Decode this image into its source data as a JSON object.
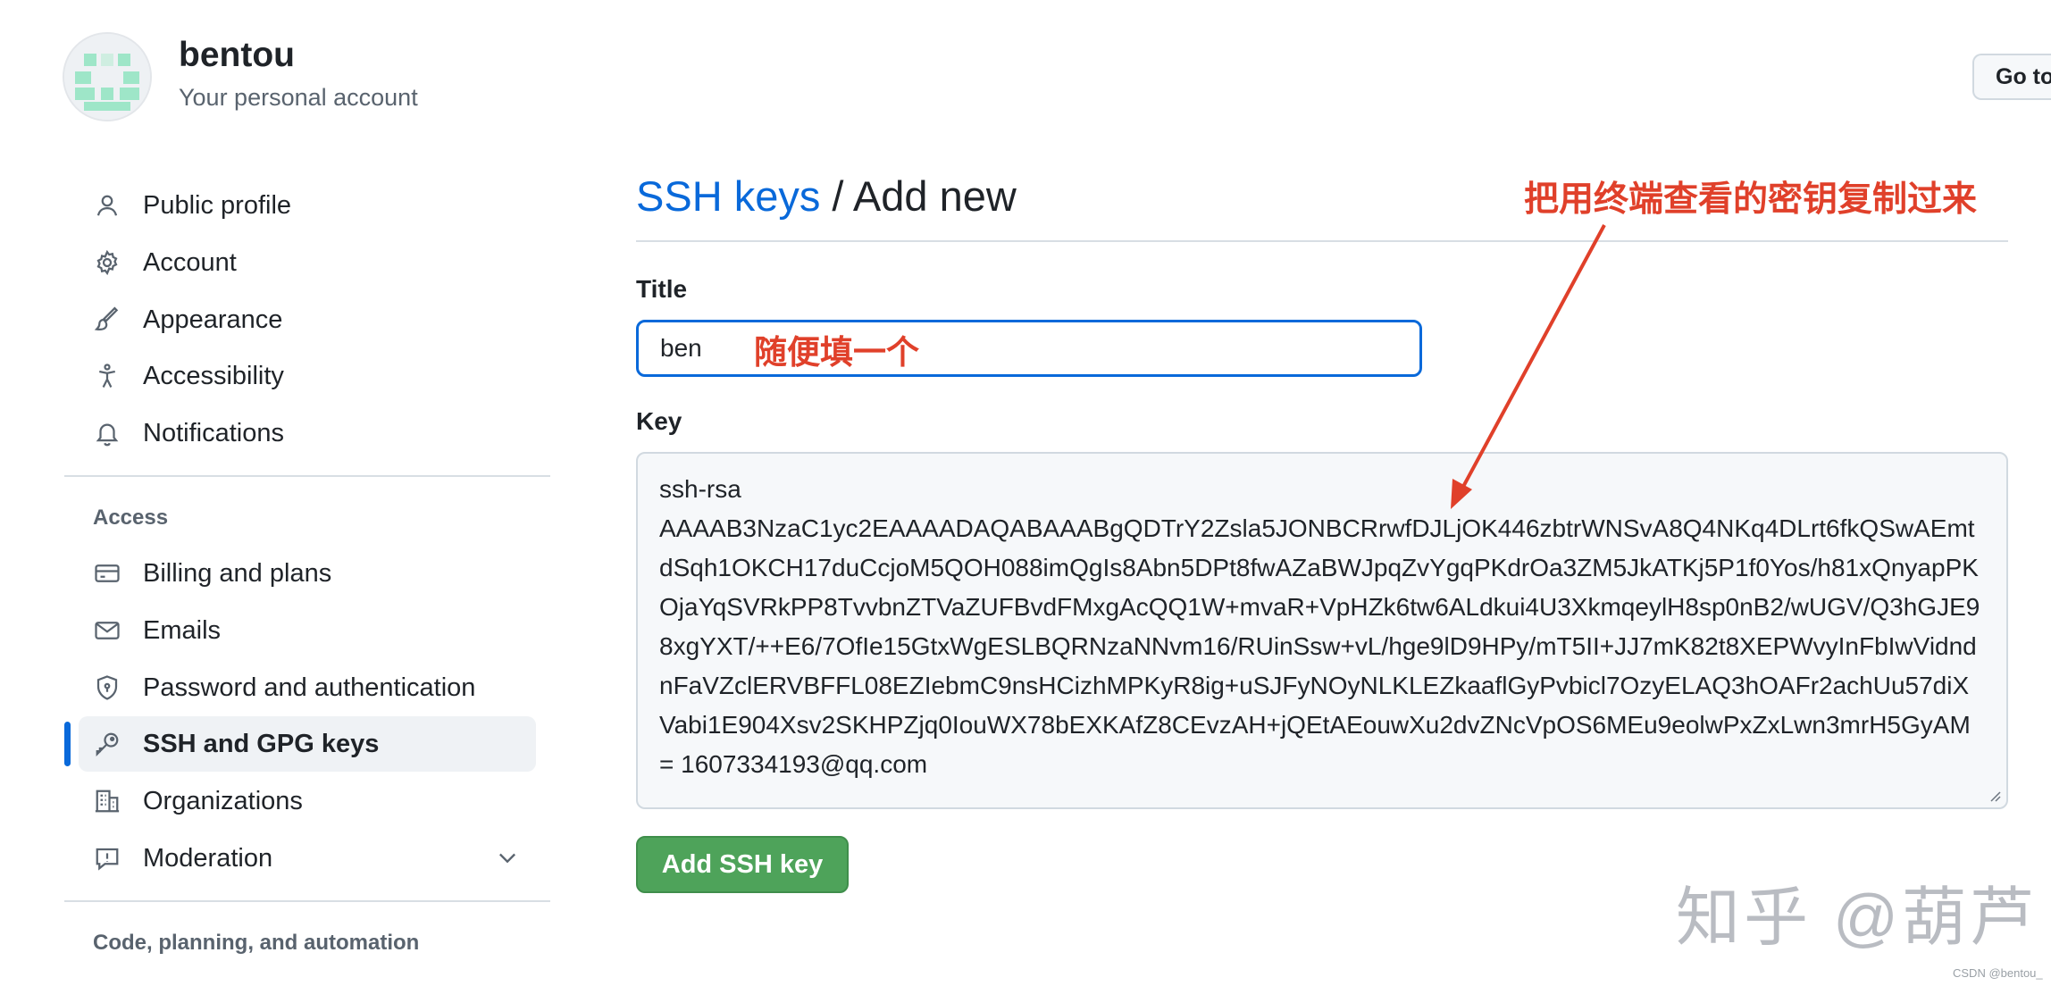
{
  "header": {
    "username": "bentou",
    "subtitle": "Your personal account",
    "goto_label": "Go to"
  },
  "sidebar": {
    "items": [
      {
        "label": "Public profile",
        "icon": "person-icon"
      },
      {
        "label": "Account",
        "icon": "gear-icon"
      },
      {
        "label": "Appearance",
        "icon": "paintbrush-icon"
      },
      {
        "label": "Accessibility",
        "icon": "accessibility-icon"
      },
      {
        "label": "Notifications",
        "icon": "bell-icon"
      }
    ],
    "access_heading": "Access",
    "access_items": [
      {
        "label": "Billing and plans",
        "icon": "credit-card-icon"
      },
      {
        "label": "Emails",
        "icon": "mail-icon"
      },
      {
        "label": "Password and authentication",
        "icon": "shield-lock-icon"
      },
      {
        "label": "SSH and GPG keys",
        "icon": "key-icon",
        "active": true
      },
      {
        "label": "Organizations",
        "icon": "organization-icon"
      },
      {
        "label": "Moderation",
        "icon": "report-icon"
      }
    ],
    "code_heading": "Code, planning, and automation"
  },
  "main": {
    "breadcrumb_link": "SSH keys",
    "breadcrumb_rest": " / Add new",
    "title_label": "Title",
    "title_value": "ben",
    "key_label": "Key",
    "key_value": "ssh-rsa\nAAAAB3NzaC1yc2EAAAADAQABAAABgQDTrY2Zsla5JONBCRrwfDJLjOK446zbtrWNSvA8Q4NKq4DLrt6fkQSwAEmtdSqh1OKCH17duCcjoM5QOH088imQgIs8Abn5DPt8fwAZaBWJpqZvYgqPKdrOa3ZM5JkATKj5P1f0Yos/h81xQnyapPKOjaYqSVRkPP8TvvbnZTVaZUFBvdFMxgAcQQ1W+mvaR+VpHZk6tw6ALdkui4U3XkmqeylH8sp0nB2/wUGV/Q3hGJE98xgYXT/++E6/7OfIe15GtxWgESLBQRNzaNNvm16/RUinSsw+vL/hge9lD9HPy/mT5II+JJ7mK82t8XEPWvyInFbIwVidndnFaVZclERVBFFL08EZIebmC9nsHCizhMPKyR8ig+uSJFyNOyNLKLEZkaaflGyPvbicl7OzyELAQ3hOAFr2achUu57diXVabi1E904Xsv2SKHPZjq0IouWX78bEXKAfZ8CEvzAH+jQEtAEouwXu2dvZNcVpOS6MEu9eolwPxZxLwn3mrH5GyAM= 1607334193@qq.com",
    "submit_label": "Add SSH key"
  },
  "annotations": {
    "title_note": "随便填一个",
    "key_note": "把用终端查看的密钥复制过来"
  },
  "watermark": "知乎 @葫芦",
  "csdn_mark": "CSDN @bentou_",
  "colors": {
    "link": "#0969da",
    "button_green": "#4ea35a",
    "annotation_red": "#e0402a",
    "active_bar": "#0969da"
  }
}
